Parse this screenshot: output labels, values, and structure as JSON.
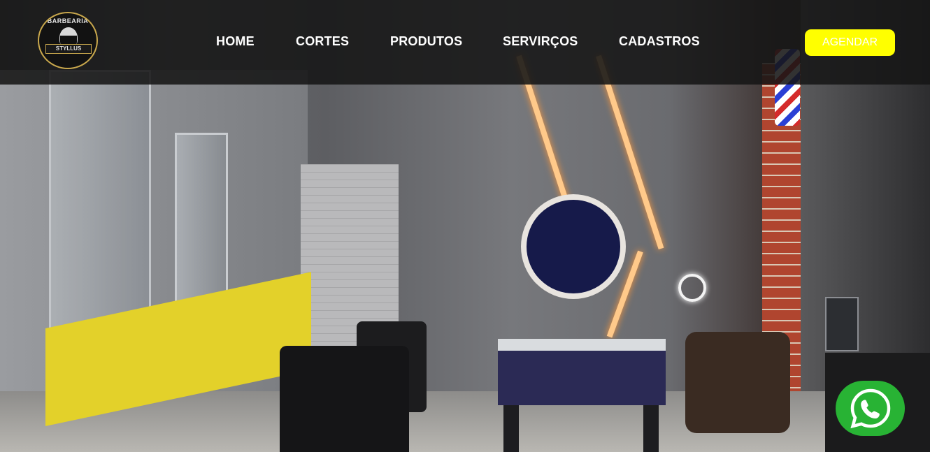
{
  "brand": {
    "logo_top": "BARBEARIA",
    "logo_name": "STYLLUS"
  },
  "nav": {
    "items": [
      {
        "label": "HOME"
      },
      {
        "label": "CORTES"
      },
      {
        "label": "PRODUTOS"
      },
      {
        "label": "SERVIRÇOS"
      },
      {
        "label": "CADASTROS"
      }
    ]
  },
  "cta": {
    "label": "AGENDAR",
    "background_color": "#ffff00",
    "text_color": "#ffffff"
  },
  "hero": {
    "image_subject": "barbershop interior"
  },
  "whatsapp": {
    "icon": "whatsapp-icon",
    "color": "#28b334"
  },
  "colors": {
    "header_overlay": "#161616"
  }
}
